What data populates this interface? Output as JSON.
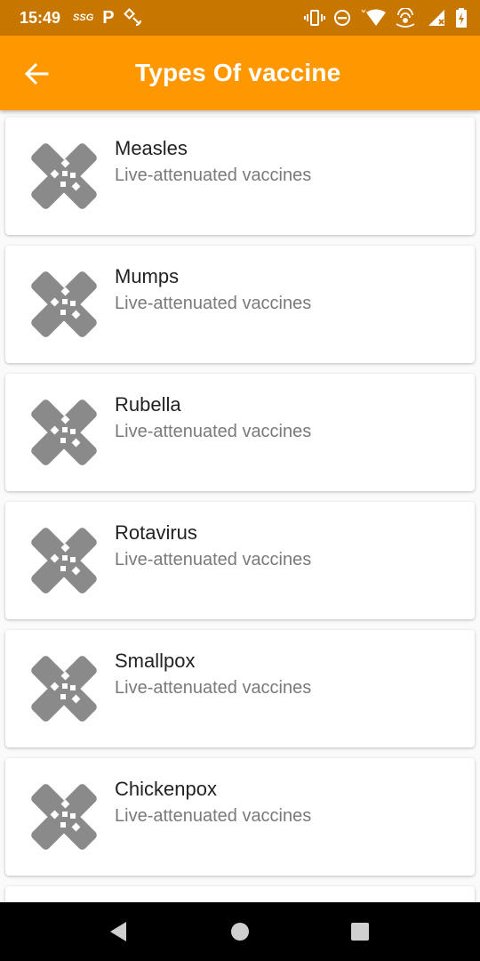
{
  "status_bar": {
    "time": "15:49",
    "ssg_label": "SSG",
    "p_label": "P",
    "icons": [
      "vibrate-icon",
      "dnd-icon",
      "wifi-icon",
      "hotspot-icon",
      "signal-icon",
      "battery-icon"
    ]
  },
  "app_bar": {
    "title": "Types Of vaccine",
    "background": "#ff9800"
  },
  "vaccines": [
    {
      "name": "Measles",
      "type": "Live-attenuated vaccines"
    },
    {
      "name": "Mumps",
      "type": "Live-attenuated vaccines"
    },
    {
      "name": "Rubella",
      "type": "Live-attenuated vaccines"
    },
    {
      "name": "Rotavirus",
      "type": "Live-attenuated vaccines"
    },
    {
      "name": "Smallpox",
      "type": "Live-attenuated vaccines"
    },
    {
      "name": "Chickenpox",
      "type": "Live-attenuated vaccines"
    }
  ],
  "nav_bar": {
    "buttons": [
      "back-icon",
      "home-icon",
      "recents-icon"
    ]
  }
}
